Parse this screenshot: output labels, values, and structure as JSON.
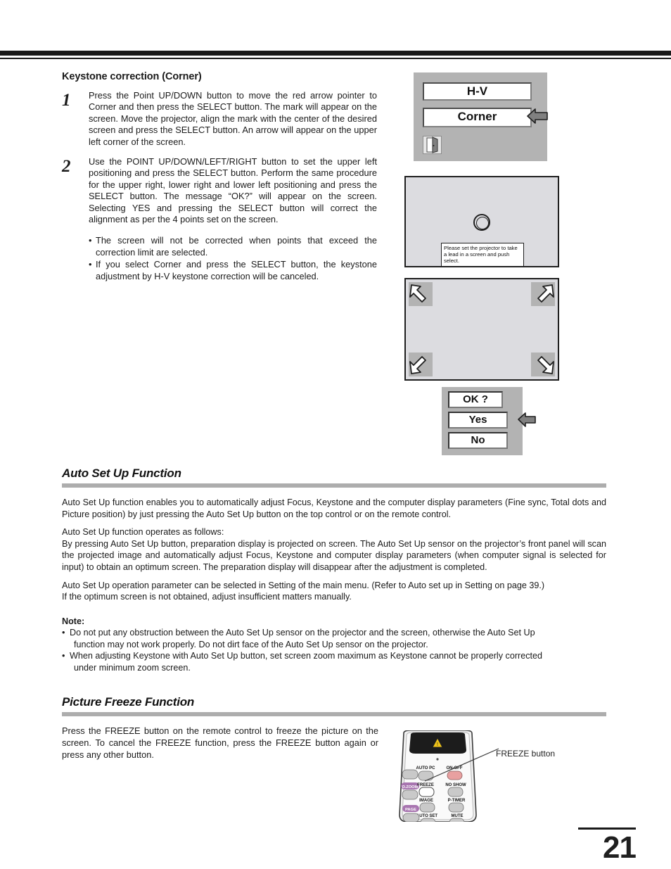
{
  "page": {
    "number": "21"
  },
  "keystone": {
    "heading": "Keystone correction (Corner)",
    "steps": [
      {
        "num": "1",
        "text": "Press the Point UP/DOWN button to move the red arrow pointer to Corner and then press the SELECT button. The mark will appear on the screen. Move the projector, align the mark with the center of the desired screen and press the SELECT button. An arrow will appear on the upper left corner of the screen."
      },
      {
        "num": "2",
        "text": "Use the POINT UP/DOWN/LEFT/RIGHT button to set the upper left positioning and press the SELECT button. Perform the same procedure for the upper right, lower right and lower left positioning and press the SELECT button. The message “OK?” will appear on the screen. Selecting YES and pressing the SELECT button will correct the alignment as per the 4 points set on the screen."
      }
    ],
    "bullets": [
      "The screen will not be corrected when points that exceed the correction limit are selected.",
      "If you select Corner and press the SELECT button, the keystone adjustment by H-V keystone correction will be canceled."
    ]
  },
  "osd_menu": {
    "hv_label": "H-V",
    "corner_label": "Corner",
    "exit_icon": "door-exit-icon",
    "pointer_icon": "left-arrow-pointer-icon"
  },
  "prep_screen": {
    "mark_icon": "target-circle-mark-icon",
    "message": "Please set the projector to take a lead in a screen and push select."
  },
  "corner_screen": {
    "arrows": [
      "upper-left-arrow-icon",
      "upper-right-arrow-icon",
      "lower-left-arrow-icon",
      "lower-right-arrow-icon"
    ]
  },
  "ok_dialog": {
    "question": "OK ?",
    "yes": "Yes",
    "no": "No",
    "pointer_icon": "left-arrow-pointer-icon"
  },
  "auto_setup": {
    "title": "Auto Set Up Function",
    "para1": "Auto Set Up function enables you to automatically adjust Focus, Keystone and the computer display parameters (Fine sync, Total dots and Picture position) by just pressing the Auto Set Up button on the top control or on the remote control.",
    "para2": "Auto Set Up function operates as follows:",
    "para3": "By pressing Auto Set Up button, preparation display is projected on screen. The Auto Set Up sensor on the projector’s front panel will scan the projected image and automatically adjust Focus, Keystone and computer display parameters (when computer signal is selected for input) to obtain an optimum screen. The preparation display will disappear after the adjustment is completed.",
    "para4": "Auto Set Up operation parameter can be selected in Setting of the main menu. (Refer to Auto set up in Setting on page 39.)",
    "para5": "If the optimum screen is not obtained, adjust insufficient matters manually.",
    "note_heading": "Note:",
    "notes": [
      {
        "line1": "Do not put any obstruction between the Auto Set Up sensor on the projector and the screen, otherwise the Auto Set Up",
        "line2": "function may not work properly. Do not dirt face of the Auto Set Up sensor on the projector."
      },
      {
        "line1": "When adjusting Keystone with Auto Set Up button, set screen zoom maximum as Keystone cannot be properly corrected",
        "line2": "under minimum zoom screen."
      }
    ]
  },
  "freeze": {
    "title": "Picture Freeze Function",
    "body": "Press the FREEZE button on the remote control to freeze the picture on the screen.  To cancel the FREEZE function, press the FREEZE button again or press any other button.",
    "callout": "FREEZE button",
    "remote_buttons": {
      "auto_pc": "AUTO PC",
      "on_off": "ON-OFF",
      "d_zoom": "D.ZOOM",
      "freeze": "FREEZE",
      "no_show": "NO SHOW",
      "image": "IMAGE",
      "p_timer": "P-TIMER",
      "page": "PAGE",
      "auto_set": "AUTO SET",
      "mute": "MUTE"
    },
    "warning_icon": "warning-triangle-icon"
  },
  "colors": {
    "osd_panel": "#b3b3b3",
    "screen_fill": "#dcdce0",
    "section_bar": "#adadad",
    "accent_purple": "#a875b0",
    "power_red": "#e8a0a0"
  }
}
